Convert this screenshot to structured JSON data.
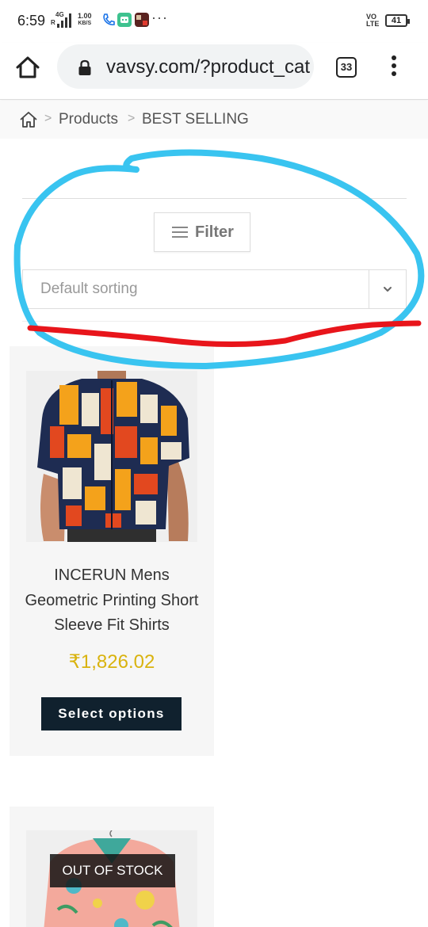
{
  "status_bar": {
    "time": "6:59",
    "network_top": "4G",
    "network_left": "R",
    "speed_value": "1.00",
    "speed_unit": "KB/S",
    "more": "···",
    "volte_top": "VO",
    "volte_bottom": "LTE",
    "battery": "41"
  },
  "browser": {
    "url": "vavsy.com/?product_cat=best-selling",
    "tab_count": "33"
  },
  "breadcrumb": {
    "sep": ">",
    "items": [
      "Products",
      "BEST SELLING"
    ]
  },
  "toolbar": {
    "filter_label": "Filter",
    "sort_value": "Default sorting"
  },
  "products": [
    {
      "title": "INCERUN Mens Geometric Printing Short Sleeve Fit Shirts",
      "price": "₹1,826.02",
      "button": "Select options"
    },
    {
      "badge": "OUT OF STOCK"
    }
  ],
  "colors": {
    "price": "#d9b30e",
    "button_bg": "#10212e",
    "annotation_circle": "#39c4f0",
    "annotation_line": "#e8151b"
  }
}
